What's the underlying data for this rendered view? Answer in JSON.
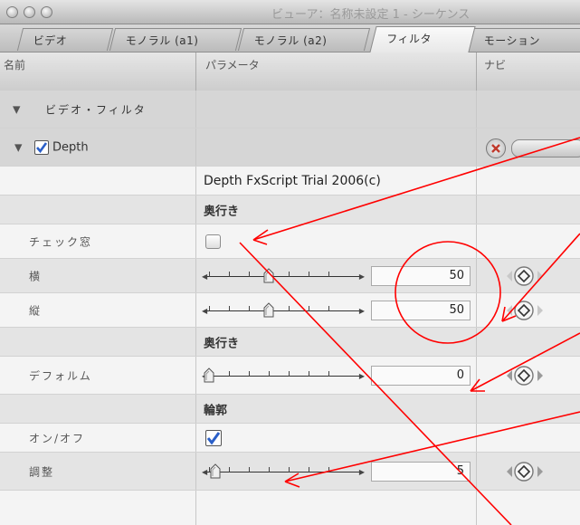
{
  "window": {
    "title": "ビューア：名称未設定 1 - シーケンス"
  },
  "tabs": [
    {
      "label": "ビデオ"
    },
    {
      "label": "モノラル (a1)"
    },
    {
      "label": "モノラル (a2)"
    },
    {
      "label": "フィルタ",
      "active": true
    },
    {
      "label": "モーション"
    }
  ],
  "columns": {
    "name": "名前",
    "params": "パラメータ",
    "nav": "ナビ"
  },
  "filter_group": {
    "label": "ビデオ・フィルタ"
  },
  "filter": {
    "name": "Depth",
    "enabled": true,
    "credit": "Depth FxScript Trial 2006(c)"
  },
  "sections": {
    "depth1": "奥行き",
    "depth2": "奥行き",
    "outline": "輪郭"
  },
  "params": {
    "check_window": {
      "label": "チェック窓",
      "checked": false
    },
    "horizontal": {
      "label": "横",
      "value": "50"
    },
    "vertical": {
      "label": "縦",
      "value": "50"
    },
    "deform": {
      "label": "デフォルム",
      "value": "0"
    },
    "onoff": {
      "label": "オン/オフ",
      "checked": true
    },
    "adjust": {
      "label": "調整",
      "value": "5"
    }
  },
  "slider_levels": {
    "horizontal": 0.5,
    "vertical": 0.5,
    "deform": 0.0,
    "adjust": 0.05
  },
  "colors": {
    "annotation": "#ff0000",
    "checkbox_accent": "#2a5fc8",
    "reset_button": "#c0392b"
  },
  "icons": {
    "reset": "close-x-icon",
    "keyframe": "diamond-icon"
  }
}
